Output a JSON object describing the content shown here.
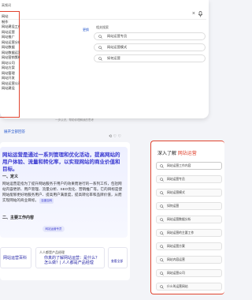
{
  "dropdown": {
    "top_tag": "高频词",
    "left_list": [
      {
        "label": "网站",
        "accent": false
      },
      {
        "label": "制作",
        "accent": false
      },
      {
        "label": "网站建设工作内容",
        "accent": false
      },
      {
        "label": "网站运营",
        "accent": false
      },
      {
        "label": "网站推广",
        "accent": false
      },
      {
        "label": "网站运营分析",
        "accent": false
      },
      {
        "label": "网站数据",
        "accent": false
      },
      {
        "label": "网站数据运营工作内容",
        "accent": false
      },
      {
        "label": "网站营销策略",
        "accent": false
      },
      {
        "label": "网站公司",
        "accent": false
      },
      {
        "label": "网站方案",
        "accent": false
      },
      {
        "label": "网站管理",
        "accent": false
      },
      {
        "label": "网站开发",
        "accent": false
      },
      {
        "label": "网站运营公司",
        "accent": false
      },
      {
        "label": "网站建设",
        "accent": false
      }
    ],
    "right_link": "更换",
    "related_title": "相关搜索",
    "suggestions": [
      "网站运营专员",
      "网站运营模式",
      "如何运营"
    ]
  },
  "background": {
    "hint_line1": "AI 生成内容 仅供参考",
    "hint_line2": "一步认识，帮助你理解我的思考",
    "more_link": "展开全部回答",
    "headline": "网站运营是通过一系列管理和优化活动，提高网站的用户体验、流量和转化率，以实现网站的商业价值和目标。",
    "section1": "一、定义",
    "para": "网站运营是指为了提升网站服务于用户的效果而进行的一系列工作，包括网站内容更新、用户管理、流量分析、SEO优化、营销推广等。它的目标是使网站能够更好地服务用户、提高用户满意度，提高转化率和品牌价值，从而实现网站的商业目标。",
    "para_badge": "百度百科",
    "section2": "二、主要工作内容",
    "pill": "网站运营专员",
    "card1_title": "网站运营百科",
    "card2_tag": "人人都是产品经理",
    "card2_title": "你真的了解网站运营：是什么？怎么做？| 人人都是产品经理",
    "card3_title": "查看全部",
    "feedback_icons": "⟲ ♡ ♡"
  },
  "side": {
    "title_prefix": "深入了解",
    "title_highlight": "网站运营",
    "items": [
      "网站运营工作内容",
      "网站运营专员",
      "网站运营模式",
      "如何运营",
      "网站运营数据分析",
      "网站运营的主要工作",
      "网站运营方案",
      "网站内容运营",
      "网站运营公司",
      "什么叫运营网站"
    ]
  },
  "colors": {
    "highlight_border": "#e0442f",
    "link_blue": "#2255cc",
    "answer_purple": "#3a3ad1"
  }
}
